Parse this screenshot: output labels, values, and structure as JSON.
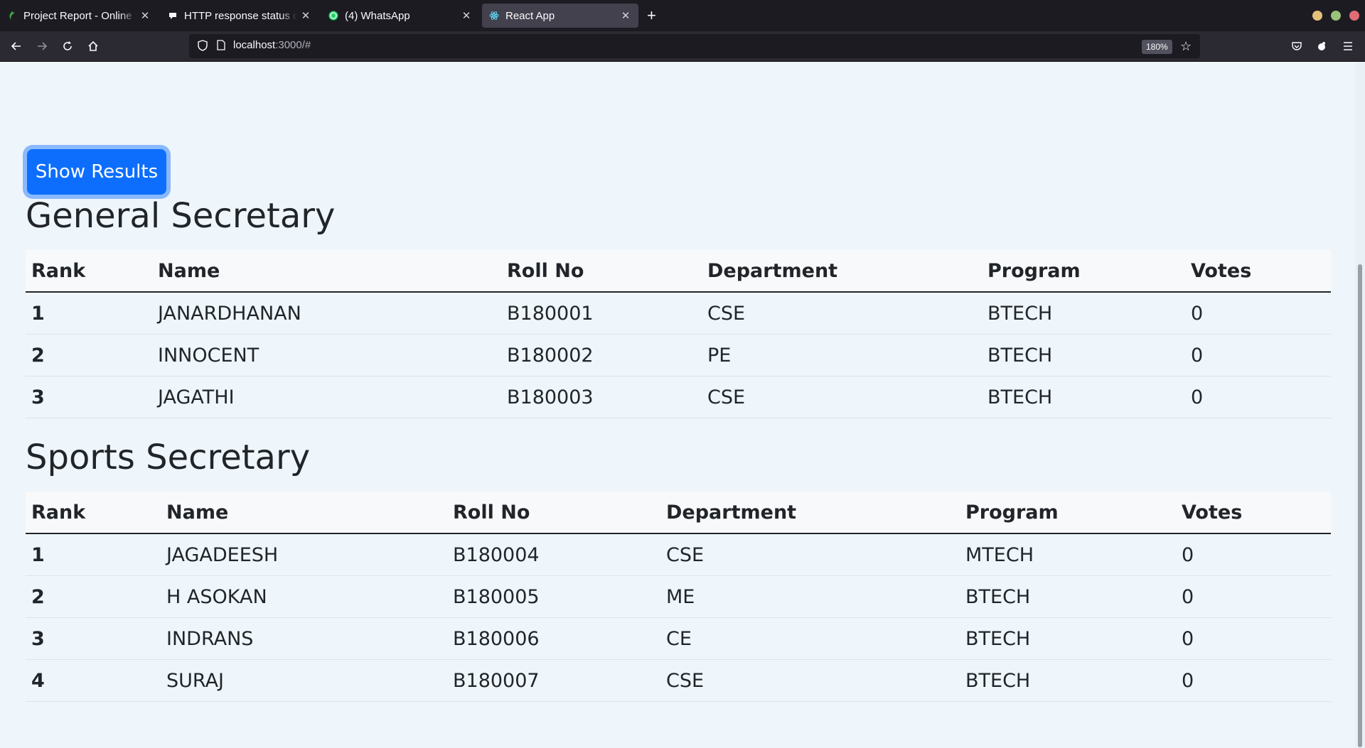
{
  "browser": {
    "tabs": [
      {
        "title": "Project Report - Online LaTeX Editor",
        "active": false
      },
      {
        "title": "HTTP response status codes",
        "active": false
      },
      {
        "title": "(4) WhatsApp",
        "active": false
      },
      {
        "title": "React App",
        "active": true
      }
    ],
    "url_host": "localhost",
    "url_rest": ":3000/#",
    "zoom": "180%"
  },
  "page": {
    "show_results_label": "Show Results",
    "columns": [
      "Rank",
      "Name",
      "Roll No",
      "Department",
      "Program",
      "Votes"
    ],
    "sections": [
      {
        "title": "General Secretary",
        "rows": [
          {
            "rank": "1",
            "name": "JANARDHANAN",
            "roll": "B180001",
            "dept": "CSE",
            "program": "BTECH",
            "votes": "0"
          },
          {
            "rank": "2",
            "name": "INNOCENT",
            "roll": "B180002",
            "dept": "PE",
            "program": "BTECH",
            "votes": "0"
          },
          {
            "rank": "3",
            "name": "JAGATHI",
            "roll": "B180003",
            "dept": "CSE",
            "program": "BTECH",
            "votes": "0"
          }
        ]
      },
      {
        "title": "Sports Secretary",
        "rows": [
          {
            "rank": "1",
            "name": "JAGADEESH",
            "roll": "B180004",
            "dept": "CSE",
            "program": "MTECH",
            "votes": "0"
          },
          {
            "rank": "2",
            "name": "H ASOKAN",
            "roll": "B180005",
            "dept": "ME",
            "program": "BTECH",
            "votes": "0"
          },
          {
            "rank": "3",
            "name": "INDRANS",
            "roll": "B180006",
            "dept": "CE",
            "program": "BTECH",
            "votes": "0"
          },
          {
            "rank": "4",
            "name": "SURAJ",
            "roll": "B180007",
            "dept": "CSE",
            "program": "BTECH",
            "votes": "0"
          }
        ]
      }
    ]
  }
}
